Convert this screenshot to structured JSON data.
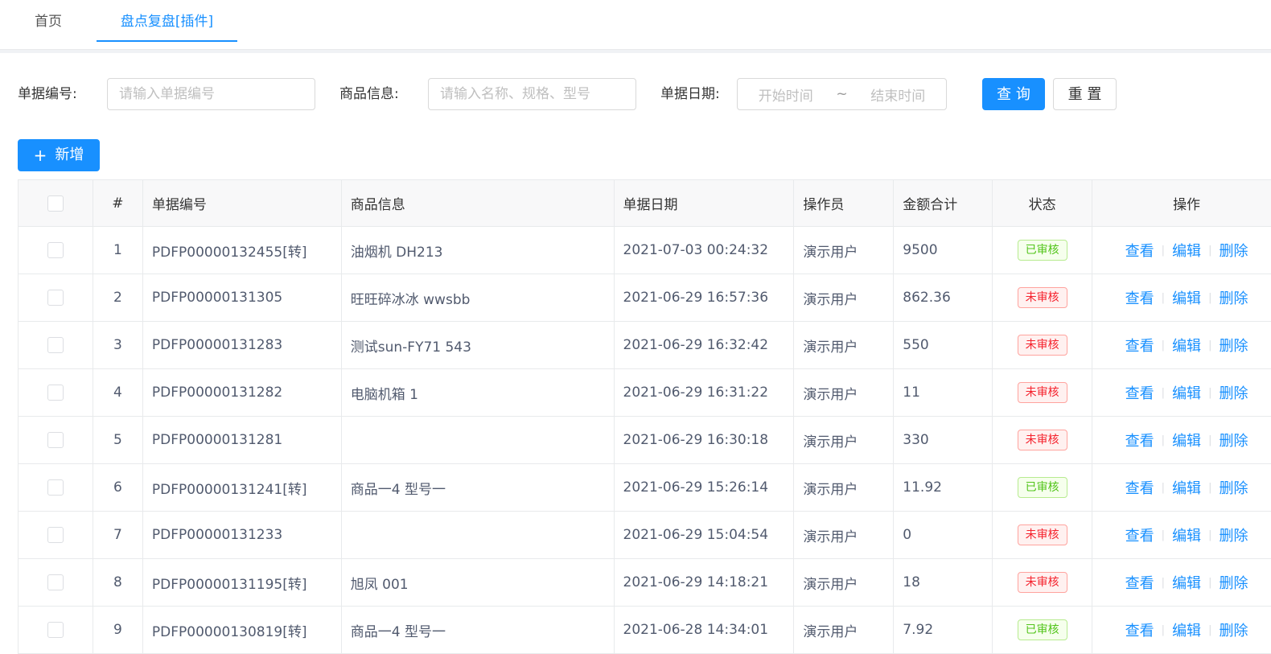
{
  "tabs": {
    "home": "首页",
    "active": "盘点复盘[插件]"
  },
  "search": {
    "doc_no_label": "单据编号:",
    "doc_no_placeholder": "请输入单据编号",
    "goods_label": "商品信息:",
    "goods_placeholder": "请输入名称、规格、型号",
    "date_label": "单据日期:",
    "date_start": "开始时间",
    "date_sep": "~",
    "date_end": "结束时间",
    "query_label": "查 询",
    "reset_label": "重 置"
  },
  "toolbar": {
    "add_icon": "+",
    "add_label": "新增"
  },
  "table": {
    "columns": [
      "#",
      "单据编号",
      "商品信息",
      "单据日期",
      "操作员",
      "金额合计",
      "状态",
      "操作"
    ],
    "actions": {
      "view": "查看",
      "edit": "编辑",
      "delete": "删除"
    },
    "rows": [
      {
        "idx": "1",
        "no": "PDFP00000132455[转]",
        "goods": "油烟机 DH213",
        "date": "2021-07-03 00:24:32",
        "operator": "演示用户",
        "amount": "9500",
        "status": "已审核"
      },
      {
        "idx": "2",
        "no": "PDFP00000131305",
        "goods": "旺旺碎冰冰 wwsbb",
        "date": "2021-06-29 16:57:36",
        "operator": "演示用户",
        "amount": "862.36",
        "status": "未审核"
      },
      {
        "idx": "3",
        "no": "PDFP00000131283",
        "goods": "测试sun-FY71 543",
        "date": "2021-06-29 16:32:42",
        "operator": "演示用户",
        "amount": "550",
        "status": "未审核"
      },
      {
        "idx": "4",
        "no": "PDFP00000131282",
        "goods": "电脑机箱 1",
        "date": "2021-06-29 16:31:22",
        "operator": "演示用户",
        "amount": "11",
        "status": "未审核"
      },
      {
        "idx": "5",
        "no": "PDFP00000131281",
        "goods": "",
        "date": "2021-06-29 16:30:18",
        "operator": "演示用户",
        "amount": "330",
        "status": "未审核"
      },
      {
        "idx": "6",
        "no": "PDFP00000131241[转]",
        "goods": "商品一4 型号一",
        "date": "2021-06-29 15:26:14",
        "operator": "演示用户",
        "amount": "11.92",
        "status": "已审核"
      },
      {
        "idx": "7",
        "no": "PDFP00000131233",
        "goods": "",
        "date": "2021-06-29 15:04:54",
        "operator": "演示用户",
        "amount": "0",
        "status": "未审核"
      },
      {
        "idx": "8",
        "no": "PDFP00000131195[转]",
        "goods": "旭凤 001",
        "date": "2021-06-29 14:18:21",
        "operator": "演示用户",
        "amount": "18",
        "status": "未审核"
      },
      {
        "idx": "9",
        "no": "PDFP00000130819[转]",
        "goods": "商品一4 型号一",
        "date": "2021-06-28 14:34:01",
        "operator": "演示用户",
        "amount": "7.92",
        "status": "已审核"
      }
    ]
  },
  "colors": {
    "primary": "#1890ff",
    "approved": "#52c41a",
    "pending": "#f5222d"
  }
}
